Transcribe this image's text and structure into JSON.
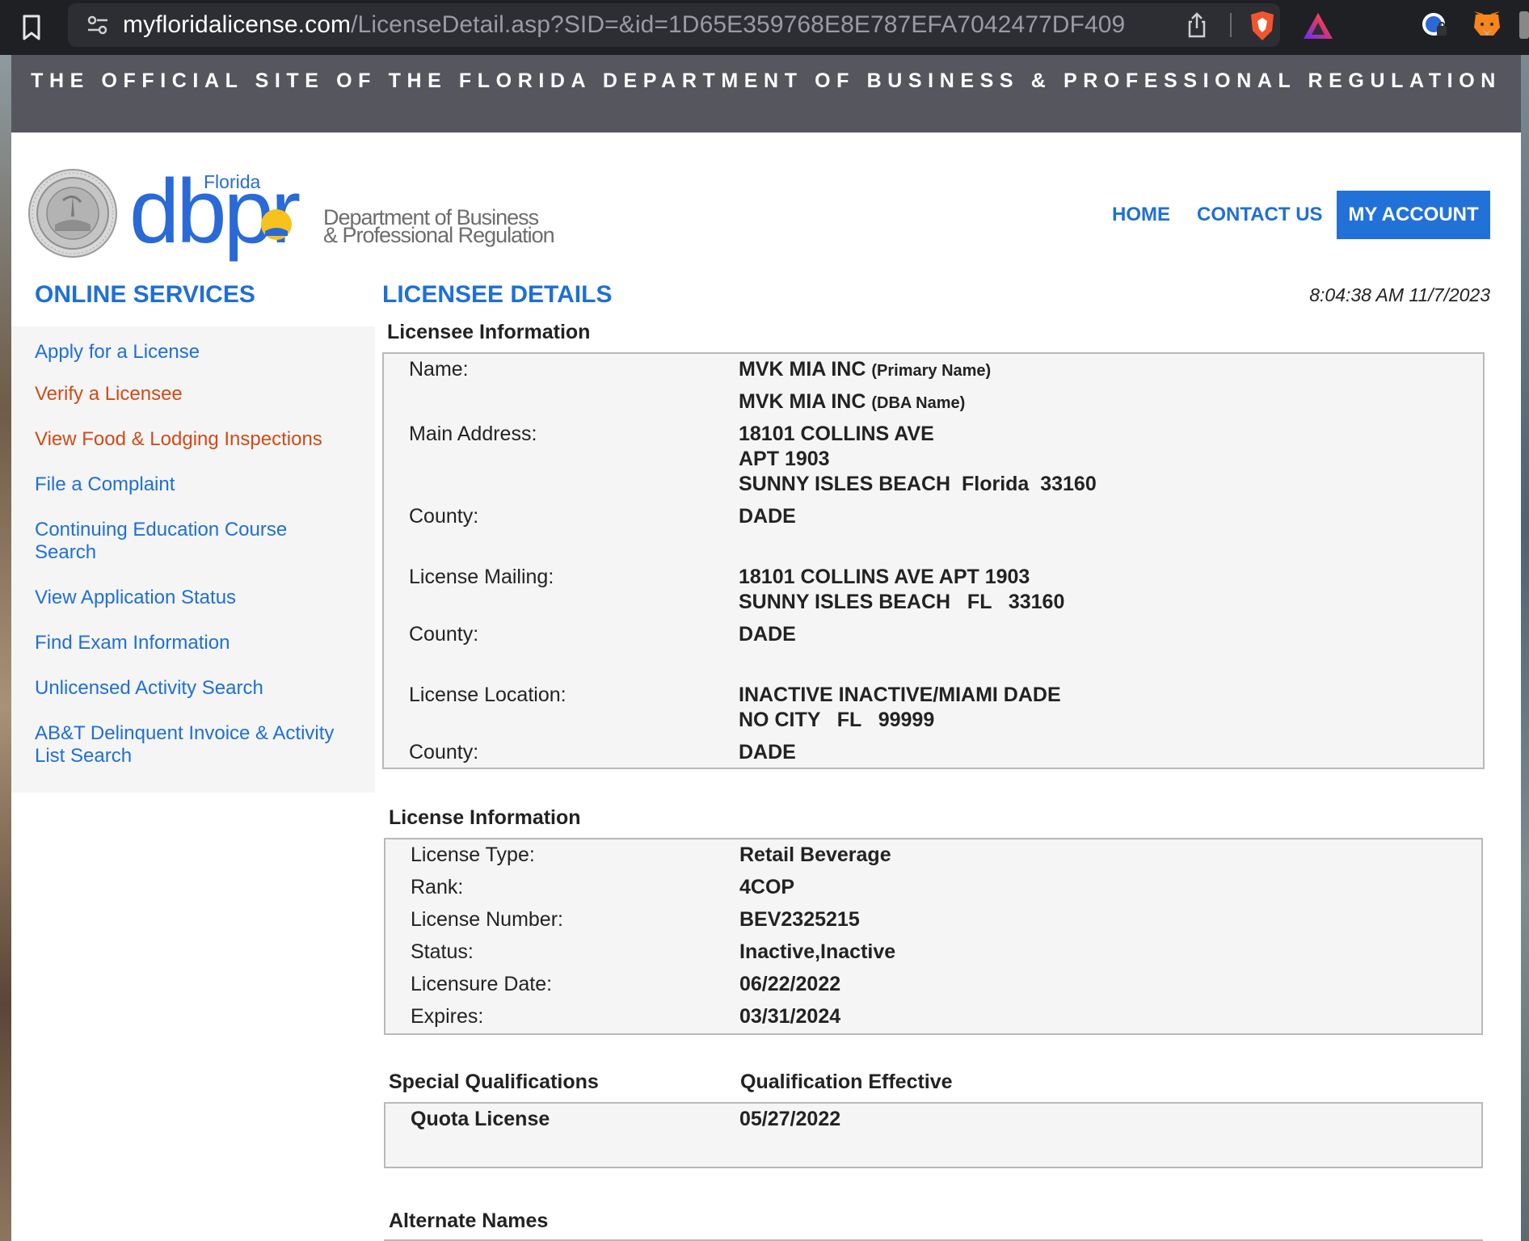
{
  "browser": {
    "url_host": "myfloridalicense.com",
    "url_path": "/LicenseDetail.asp?SID=&id=1D65E359768E8E787EFA7042477DF409"
  },
  "banner": {
    "text": "THE OFFICIAL SITE OF THE FLORIDA DEPARTMENT OF BUSINESS & PROFESSIONAL REGULATION"
  },
  "logo": {
    "florida": "Florida",
    "wordmark": "dbpr",
    "line1": "Department of Business",
    "line2": "& Professional Regulation"
  },
  "nav": {
    "home": "HOME",
    "contact": "CONTACT US",
    "account": "MY ACCOUNT"
  },
  "sidebar": {
    "title": "ONLINE SERVICES",
    "items": [
      {
        "label": "Apply for a License"
      },
      {
        "label": "Verify a Licensee"
      },
      {
        "label": "View Food & Lodging Inspections"
      },
      {
        "label": "File a Complaint"
      },
      {
        "label": "Continuing Education Course Search"
      },
      {
        "label": "View Application Status"
      },
      {
        "label": "Find Exam Information"
      },
      {
        "label": "Unlicensed Activity Search"
      },
      {
        "label": "AB&T Delinquent Invoice & Activity List Search"
      }
    ]
  },
  "main": {
    "title": "LICENSEE DETAILS",
    "timestamp": "8:04:38 AM 11/7/2023",
    "licensee": {
      "heading": "Licensee Information",
      "name_label": "Name:",
      "primary_name": "MVK MIA INC",
      "primary_tag": "(Primary Name)",
      "dba_name": "MVK MIA INC",
      "dba_tag": "(DBA Name)",
      "main_address_label": "Main Address:",
      "main_address": [
        "18101 COLLINS AVE",
        "APT 1903",
        "SUNNY ISLES BEACH  Florida  33160"
      ],
      "county_label": "County:",
      "main_county": "DADE",
      "mailing_label": "License Mailing:",
      "mailing_address": [
        "18101 COLLINS AVE APT 1903",
        "SUNNY ISLES BEACH   FL   33160"
      ],
      "mailing_county": "DADE",
      "location_label": "License Location:",
      "location_address": [
        "INACTIVE INACTIVE/MIAMI DADE",
        "NO CITY   FL   99999"
      ],
      "location_county": "DADE"
    },
    "license": {
      "heading": "License Information",
      "rows": [
        {
          "label": "License Type:",
          "value": "Retail Beverage"
        },
        {
          "label": "Rank:",
          "value": "4COP"
        },
        {
          "label": "License Number:",
          "value": "BEV2325215"
        },
        {
          "label": "Status:",
          "value": "Inactive,Inactive"
        },
        {
          "label": "Licensure Date:",
          "value": "06/22/2022"
        },
        {
          "label": "Expires:",
          "value": "03/31/2024"
        }
      ]
    },
    "qualifications": {
      "heading": "Special Qualifications",
      "effective_heading": "Qualification Effective",
      "name": "Quota License",
      "date": "05/27/2022"
    },
    "alternate_names": {
      "heading": "Alternate Names"
    }
  },
  "colors": {
    "link_blue": "#1f6fd6",
    "link_orange": "#d14a17",
    "banner_gray": "#56565f",
    "panel_gray": "#f5f5f5"
  }
}
